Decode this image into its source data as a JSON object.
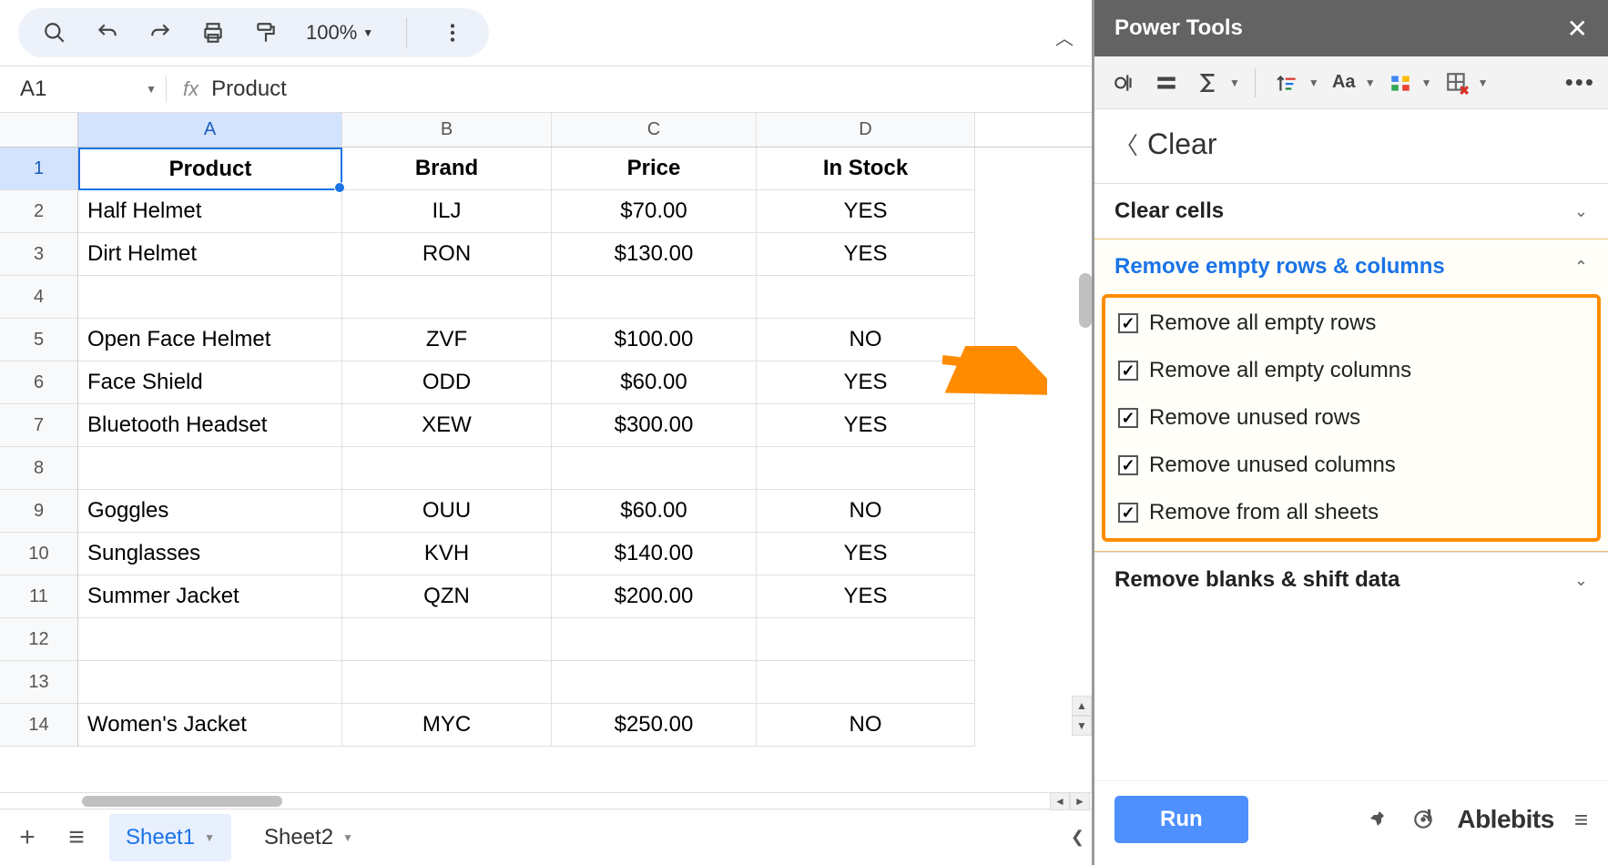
{
  "toolbar": {
    "zoom": "100%"
  },
  "formula_bar": {
    "cell_ref": "A1",
    "value": "Product"
  },
  "columns": [
    "A",
    "B",
    "C",
    "D"
  ],
  "selected_col": "A",
  "selected_row": 1,
  "grid": {
    "headers": [
      "Product",
      "Brand",
      "Price",
      "In Stock"
    ],
    "rows": [
      {
        "n": 1,
        "a": "Product",
        "b": "Brand",
        "c": "Price",
        "d": "In Stock",
        "hdr": true
      },
      {
        "n": 2,
        "a": "Half Helmet",
        "b": "ILJ",
        "c": "$70.00",
        "d": "YES"
      },
      {
        "n": 3,
        "a": "Dirt Helmet",
        "b": "RON",
        "c": "$130.00",
        "d": "YES"
      },
      {
        "n": 4,
        "a": "",
        "b": "",
        "c": "",
        "d": ""
      },
      {
        "n": 5,
        "a": "Open Face Helmet",
        "b": "ZVF",
        "c": "$100.00",
        "d": "NO"
      },
      {
        "n": 6,
        "a": "Face Shield",
        "b": "ODD",
        "c": "$60.00",
        "d": "YES"
      },
      {
        "n": 7,
        "a": "Bluetooth Headset",
        "b": "XEW",
        "c": "$300.00",
        "d": "YES"
      },
      {
        "n": 8,
        "a": "",
        "b": "",
        "c": "",
        "d": ""
      },
      {
        "n": 9,
        "a": "Goggles",
        "b": "OUU",
        "c": "$60.00",
        "d": "NO"
      },
      {
        "n": 10,
        "a": "Sunglasses",
        "b": "KVH",
        "c": "$140.00",
        "d": "YES"
      },
      {
        "n": 11,
        "a": "Summer Jacket",
        "b": "QZN",
        "c": "$200.00",
        "d": "YES"
      },
      {
        "n": 12,
        "a": "",
        "b": "",
        "c": "",
        "d": ""
      },
      {
        "n": 13,
        "a": "",
        "b": "",
        "c": "",
        "d": ""
      },
      {
        "n": 14,
        "a": "Women's Jacket",
        "b": "MYC",
        "c": "$250.00",
        "d": "NO"
      }
    ]
  },
  "sheets": [
    {
      "name": "Sheet1",
      "active": true
    },
    {
      "name": "Sheet2",
      "active": false
    }
  ],
  "panel": {
    "title": "Power Tools",
    "breadcrumb": "Clear",
    "sections": {
      "clear_cells": "Clear cells",
      "remove_empty": "Remove empty rows & columns",
      "remove_blanks": "Remove blanks & shift data"
    },
    "options": [
      {
        "label": "Remove all empty rows",
        "checked": true
      },
      {
        "label": "Remove all empty columns",
        "checked": true
      },
      {
        "label": "Remove unused rows",
        "checked": true
      },
      {
        "label": "Remove unused columns",
        "checked": true
      },
      {
        "label": "Remove from all sheets",
        "checked": true
      }
    ],
    "run_label": "Run",
    "brand": "Ablebits"
  }
}
